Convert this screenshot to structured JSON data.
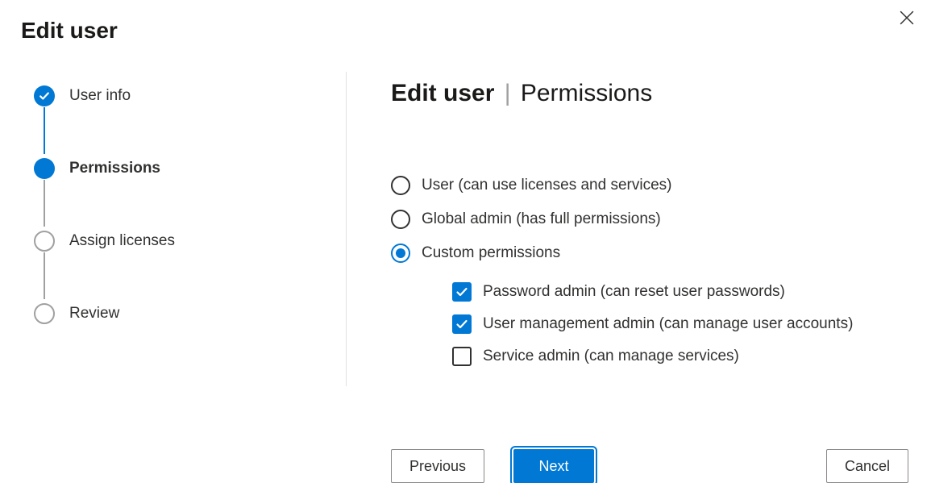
{
  "modal": {
    "title": "Edit user"
  },
  "stepper": {
    "steps": [
      {
        "label": "User info",
        "state": "completed"
      },
      {
        "label": "Permissions",
        "state": "current"
      },
      {
        "label": "Assign licenses",
        "state": "upcoming"
      },
      {
        "label": "Review",
        "state": "upcoming"
      }
    ]
  },
  "page": {
    "heading_prefix": "Edit user",
    "heading_suffix": "Permissions"
  },
  "permissions": {
    "options": [
      {
        "label": "User (can use licenses and services)",
        "selected": false
      },
      {
        "label": "Global admin (has full permissions)",
        "selected": false
      },
      {
        "label": "Custom permissions",
        "selected": true
      }
    ],
    "custom": [
      {
        "label": "Password admin (can reset user passwords)",
        "checked": true
      },
      {
        "label": "User management admin (can manage user accounts)",
        "checked": true
      },
      {
        "label": "Service admin (can manage services)",
        "checked": false
      }
    ]
  },
  "buttons": {
    "previous": "Previous",
    "next": "Next",
    "cancel": "Cancel"
  }
}
